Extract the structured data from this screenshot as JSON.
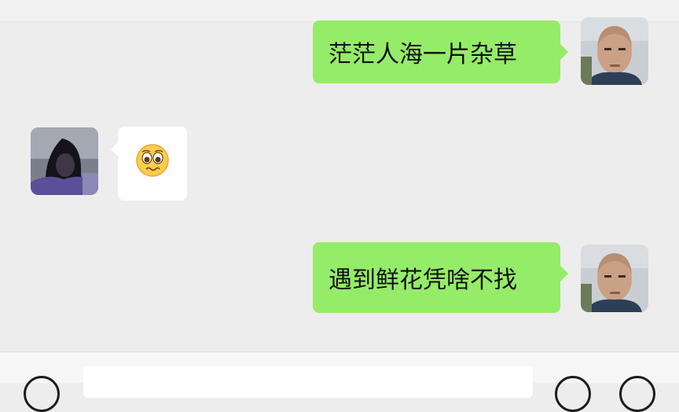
{
  "messages": [
    {
      "side": "right",
      "type": "text",
      "text": "茫茫人海一片杂草",
      "sender": "self"
    },
    {
      "side": "left",
      "type": "emoji",
      "emoji": "🥺",
      "sender": "contact"
    },
    {
      "side": "right",
      "type": "text",
      "text": "遇到鲜花凭啥不找",
      "sender": "self"
    }
  ],
  "colors": {
    "background": "#ededed",
    "sent_bubble": "#95ec69",
    "received_bubble": "#ffffff",
    "text": "#111111"
  },
  "input_bar": {
    "left_icon": "voice-icon",
    "right_icons": [
      "emoji-icon",
      "plus-icon"
    ]
  }
}
